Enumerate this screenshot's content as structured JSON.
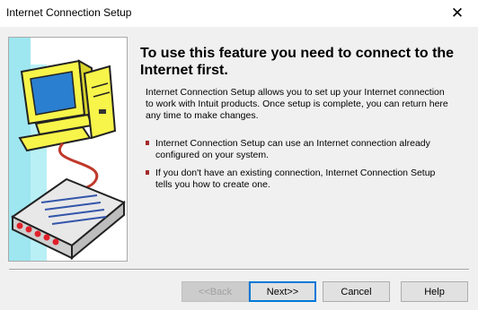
{
  "window": {
    "title": "Internet Connection Setup",
    "close_glyph": "✕"
  },
  "content": {
    "heading": "To use this feature you need to connect to the Internet first.",
    "description": "Internet Connection Setup allows you to set up your Internet connection to work with Intuit products. Once setup is complete, you can return here any time to make changes.",
    "bullets": [
      "Internet Connection Setup can use an Internet connection already configured on your system.",
      "If you don't have an existing connection, Internet Connection Setup tells you how to create one."
    ]
  },
  "illustration": {
    "name": "computer-and-modem-illustration",
    "colors": {
      "monitor": "#f7f44a",
      "screen": "#2a7fd0",
      "cable": "#c0392b",
      "modem": "#e8e8e8",
      "lights": "#e0202a",
      "panel": "#9ee6f0"
    }
  },
  "buttons": {
    "back": "<<Back",
    "next": "Next>>",
    "cancel": "Cancel",
    "help": "Help"
  }
}
